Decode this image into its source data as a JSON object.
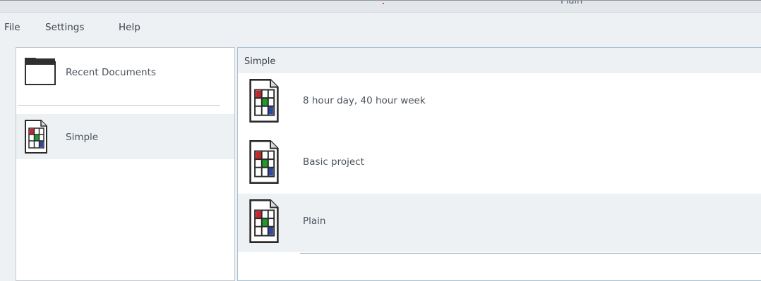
{
  "window": {
    "title": "Plain"
  },
  "menu": [
    "File",
    "Settings",
    "Help"
  ],
  "sidebar": {
    "items": [
      {
        "label": "Recent Documents",
        "icon": "folder-icon"
      },
      {
        "label": "Simple",
        "icon": "spreadsheet-document-icon",
        "selected": true
      }
    ]
  },
  "main": {
    "header": "Simple",
    "templates": [
      {
        "label": "8 hour day, 40 hour week",
        "icon": "spreadsheet-document-icon"
      },
      {
        "label": "Basic project",
        "icon": "spreadsheet-document-icon"
      },
      {
        "label": "Plain",
        "icon": "spreadsheet-document-icon",
        "selected": true
      }
    ]
  },
  "colors": {
    "background": "#eef1f4",
    "panel": "#ffffff",
    "selection": "#eef1f4",
    "focus_border": "#a9bfd3",
    "icon_red": "#c8252b",
    "icon_green": "#1f9a2b",
    "icon_blue": "#2f48a5"
  }
}
